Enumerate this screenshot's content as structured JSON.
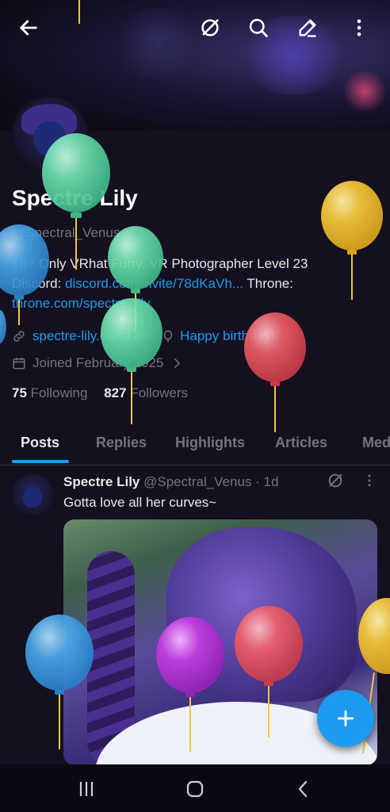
{
  "profile": {
    "name": "Spectre Lily",
    "handle": "@Spectral_Venus",
    "bio_prefix": "18+",
    "bio_line1": " Only VRhat Furry, VR Photographer Level 23",
    "bio_discord_label": "Discord: ",
    "bio_discord_link": "discord.com/invite/78dKaVh...",
    "bio_throne_label": " Throne:",
    "bio_throne_link": "throne.com/spectre_lily",
    "website": "spectre-lily.carrd.co",
    "birthday": "Happy birthday!",
    "joined": "Joined February 2025",
    "following_count": "75",
    "following_label": "Following",
    "followers_count": "827",
    "followers_label": "Followers"
  },
  "tabs": [
    "Posts",
    "Replies",
    "Highlights",
    "Articles",
    "Med"
  ],
  "post": {
    "author": "Spectre Lily",
    "handle_time": "@Spectral_Venus · 1d",
    "text": "Gotta love all her curves~"
  },
  "icons": {
    "back": "arrow-left-icon",
    "grok": "grok-icon",
    "search": "search-icon",
    "edit": "edit-icon",
    "more": "more-vertical-icon"
  },
  "colors": {
    "accent": "#1d9bf0",
    "background": "#15101f",
    "muted": "#71767b"
  }
}
